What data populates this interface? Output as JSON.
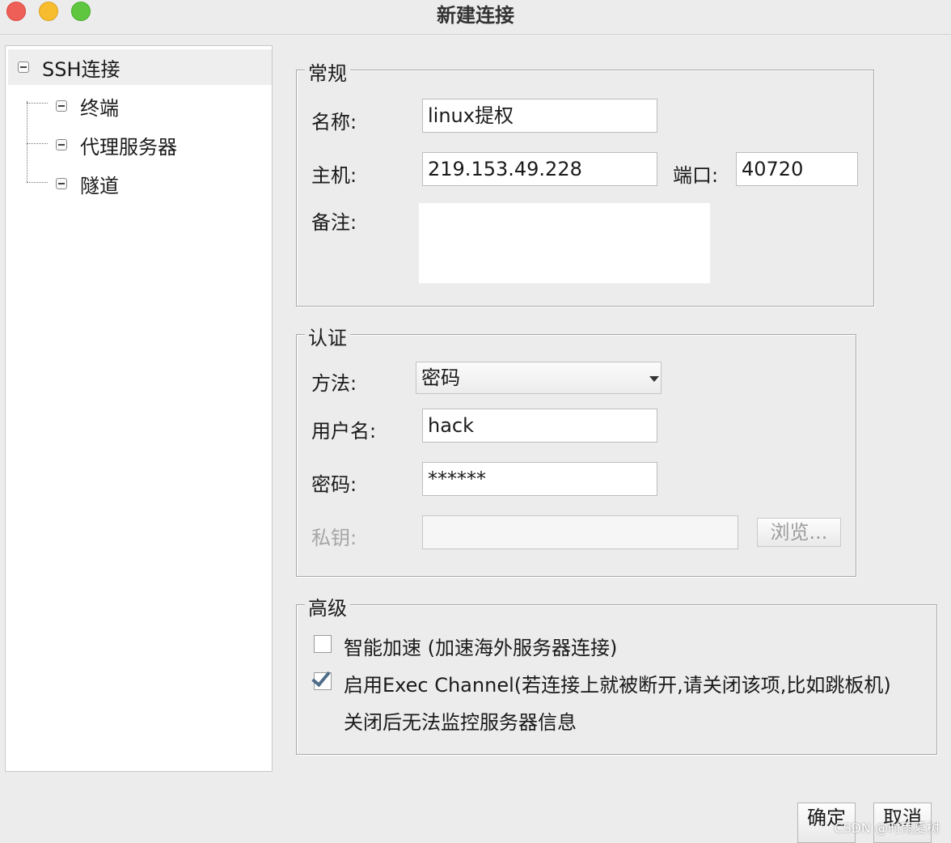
{
  "window": {
    "title": "新建连接"
  },
  "tree": {
    "root": "SSH连接",
    "children": [
      "终端",
      "代理服务器",
      "隧道"
    ]
  },
  "general": {
    "legend": "常规",
    "name_label": "名称:",
    "name_value": "linux提权",
    "host_label": "主机:",
    "host_value": "219.153.49.228",
    "port_label": "端口:",
    "port_value": "40720",
    "notes_label": "备注:",
    "notes_value": ""
  },
  "auth": {
    "legend": "认证",
    "method_label": "方法:",
    "method_value": "密码",
    "username_label": "用户名:",
    "username_value": "hack",
    "password_label": "密码:",
    "password_value": "******",
    "key_label": "私钥:",
    "key_value": "",
    "browse_label": "浏览..."
  },
  "advanced": {
    "legend": "高级",
    "smart_accel_label": "智能加速 (加速海外服务器连接)",
    "smart_accel_checked": false,
    "exec_channel_label": "启用Exec Channel(若连接上就被断开,请关闭该项,比如跳板机)",
    "exec_channel_checked": true,
    "exec_channel_note": "关闭后无法监控服务器信息"
  },
  "footer": {
    "ok_label": "确定",
    "cancel_label": "取消"
  },
  "watermark": "CSDN @时雨夏树",
  "colors": {
    "close": "#ee5f57",
    "minimize": "#f7bd2e",
    "maximize": "#5fc73f",
    "check": "#4f6c88"
  }
}
